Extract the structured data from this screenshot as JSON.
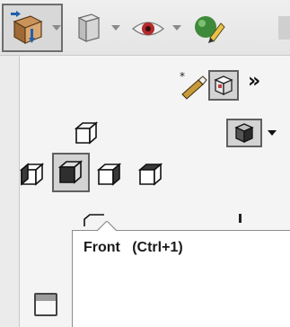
{
  "toolbar": {
    "items": [
      {
        "icon": "view-orientation-icon",
        "dropdown": true,
        "active": true
      },
      {
        "icon": "display-style-icon",
        "dropdown": true
      },
      {
        "icon": "hide-show-items-icon",
        "dropdown": true
      },
      {
        "icon": "edit-appearance-icon",
        "dropdown": false
      }
    ]
  },
  "view_panel": {
    "overflow_label": "»",
    "orientation_buttons": [
      "top",
      "left",
      "front",
      "right",
      "back"
    ]
  },
  "tooltip": {
    "text": "Front   (Ctrl+1)"
  }
}
